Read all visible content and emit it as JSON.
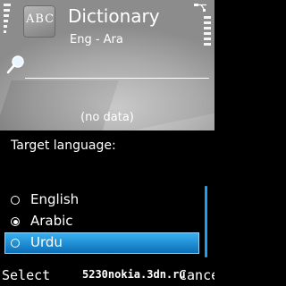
{
  "header": {
    "app_icon_text": "ABC",
    "title": "Dictionary",
    "subtitle": "Eng - Ara"
  },
  "search": {
    "value": "",
    "icon": "magnifier-icon"
  },
  "content": {
    "empty_text": "(no data)"
  },
  "popup": {
    "title": "Target language:",
    "options": [
      {
        "label": "English",
        "selected": false,
        "highlighted": false
      },
      {
        "label": "Arabic",
        "selected": true,
        "highlighted": false
      },
      {
        "label": "Urdu",
        "selected": false,
        "highlighted": true
      }
    ]
  },
  "softkeys": {
    "left": "Select",
    "right": "Cancel"
  },
  "watermark": "5230nokia.3dn.ru",
  "colors": {
    "highlight": "#1a8fd8",
    "text": "#ffffff",
    "popup_bg": "#000000"
  }
}
